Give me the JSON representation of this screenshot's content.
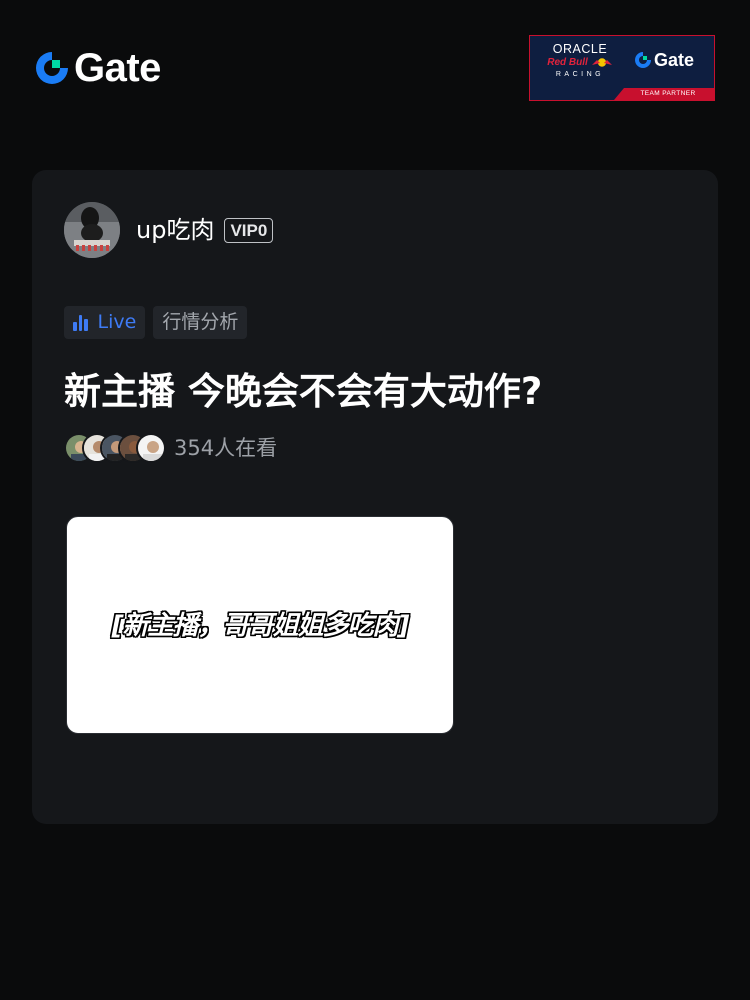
{
  "header": {
    "brand": "Gate",
    "brand_color": "#1a7cf5",
    "partner": {
      "oracle": "ORACLE",
      "red_bull": "Red Bull",
      "racing": "RACING",
      "gate": "Gate",
      "band": "TEAM PARTNER"
    }
  },
  "post": {
    "username": "up吃肉",
    "vip_badge": "VIP0",
    "tags": [
      {
        "label": "Live",
        "icon": "bar-chart-icon",
        "color": "#3e7bf5"
      },
      {
        "label": "行情分析"
      }
    ],
    "title": "新主播 今晚会不会有大动作?",
    "viewers_text": "354人在看",
    "cover_caption": "[新主播，哥哥姐姐多吃肉]"
  }
}
